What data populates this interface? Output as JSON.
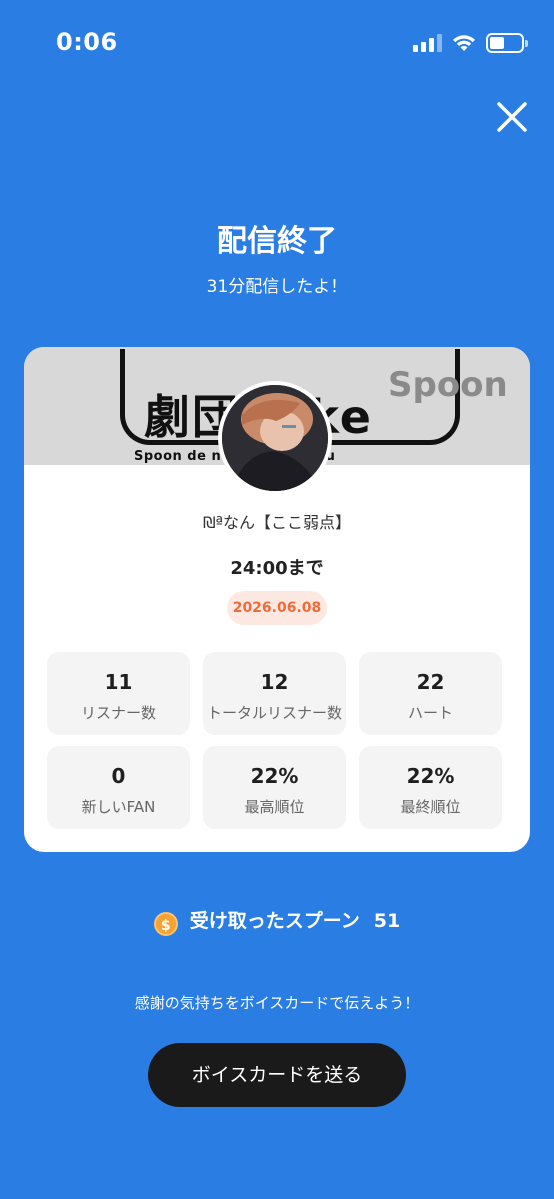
{
  "status_bar": {
    "time": "0:06"
  },
  "header": {
    "title": "配信終了",
    "subtitle": "31分配信したよ！"
  },
  "card": {
    "cover": {
      "text_large": "劇団 ikke",
      "text_small": "Spoon de nikki totatidesu",
      "brand": "Spoon"
    },
    "username": "₪ªなん【ここ弱点】",
    "until": "24:00まで",
    "date": "2026.06.08",
    "stats": [
      {
        "value": "11",
        "label": "リスナー数"
      },
      {
        "value": "12",
        "label": "トータルリスナー数"
      },
      {
        "value": "22",
        "label": "ハート"
      },
      {
        "value": "0",
        "label": "新しいFAN"
      },
      {
        "value": "22%",
        "label": "最高順位"
      },
      {
        "value": "22%",
        "label": "最終順位"
      }
    ]
  },
  "spoons": {
    "coin_symbol": "$",
    "label": "受け取ったスプーン",
    "count": "51"
  },
  "thanks_text": "感謝の気持ちをボイスカードで伝えよう！",
  "send_button": "ボイスカードを送る",
  "colors": {
    "background": "#2a7de2",
    "date_badge_bg": "#fde9e1",
    "date_badge_text": "#ef6b3a",
    "button": "#1a1a1a"
  }
}
